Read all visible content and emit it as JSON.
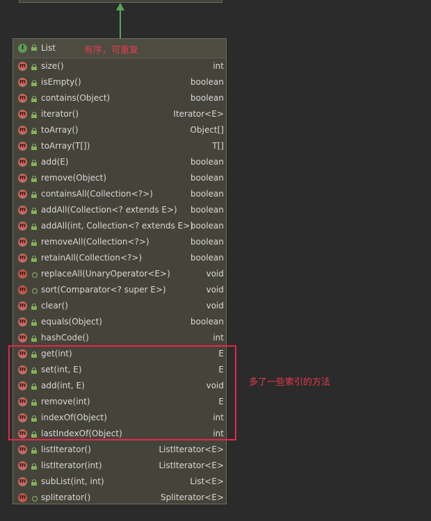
{
  "class": {
    "name": "List",
    "kind_icon": "I",
    "note": "有序，可重复"
  },
  "highlight_note": "多了一些索引的方法",
  "colors": {
    "background": "#2b2b2b",
    "box": "#45443a",
    "arrow": "#5aa65a",
    "annotation": "#e8264a",
    "method_icon": "#c46b60",
    "interface_icon": "#5f9a57"
  },
  "methods": [
    {
      "name": "size()",
      "type": "int",
      "icon": "m",
      "lock": true
    },
    {
      "name": "isEmpty()",
      "type": "boolean",
      "icon": "m",
      "lock": true
    },
    {
      "name": "contains(Object)",
      "type": "boolean",
      "icon": "m",
      "lock": true
    },
    {
      "name": "iterator()",
      "type": "Iterator<E>",
      "icon": "m",
      "lock": true
    },
    {
      "name": "toArray()",
      "type": "Object[]",
      "icon": "m",
      "lock": true
    },
    {
      "name": "toArray(T[])",
      "type": "T[]",
      "icon": "m",
      "lock": true
    },
    {
      "name": "add(E)",
      "type": "boolean",
      "icon": "m",
      "lock": true
    },
    {
      "name": "remove(Object)",
      "type": "boolean",
      "icon": "m",
      "lock": true
    },
    {
      "name": "containsAll(Collection<?>)",
      "type": "boolean",
      "icon": "m",
      "lock": true
    },
    {
      "name": "addAll(Collection<? extends E>)",
      "type": "boolean",
      "icon": "m",
      "lock": true
    },
    {
      "name": "addAll(int, Collection<? extends E>)",
      "type": "boolean",
      "icon": "m",
      "lock": true
    },
    {
      "name": "removeAll(Collection<?>)",
      "type": "boolean",
      "icon": "m",
      "lock": true
    },
    {
      "name": "retainAll(Collection<?>)",
      "type": "boolean",
      "icon": "m",
      "lock": true
    },
    {
      "name": "replaceAll(UnaryOperator<E>)",
      "type": "void",
      "icon": "m",
      "lock": false
    },
    {
      "name": "sort(Comparator<? super E>)",
      "type": "void",
      "icon": "m",
      "lock": false
    },
    {
      "name": "clear()",
      "type": "void",
      "icon": "m",
      "lock": true
    },
    {
      "name": "equals(Object)",
      "type": "boolean",
      "icon": "m",
      "lock": true
    },
    {
      "name": "hashCode()",
      "type": "int",
      "icon": "m",
      "lock": true
    },
    {
      "name": "get(int)",
      "type": "E",
      "icon": "m",
      "lock": true
    },
    {
      "name": "set(int, E)",
      "type": "E",
      "icon": "m",
      "lock": true
    },
    {
      "name": "add(int, E)",
      "type": "void",
      "icon": "m",
      "lock": true
    },
    {
      "name": "remove(int)",
      "type": "E",
      "icon": "m",
      "lock": true
    },
    {
      "name": "indexOf(Object)",
      "type": "int",
      "icon": "m",
      "lock": true
    },
    {
      "name": "lastIndexOf(Object)",
      "type": "int",
      "icon": "m",
      "lock": true
    },
    {
      "name": "listIterator()",
      "type": "ListIterator<E>",
      "icon": "m",
      "lock": true
    },
    {
      "name": "listIterator(int)",
      "type": "ListIterator<E>",
      "icon": "m",
      "lock": true
    },
    {
      "name": "subList(int, int)",
      "type": "List<E>",
      "icon": "m",
      "lock": true
    },
    {
      "name": "spliterator()",
      "type": "Spliterator<E>",
      "icon": "m",
      "lock": false
    }
  ]
}
